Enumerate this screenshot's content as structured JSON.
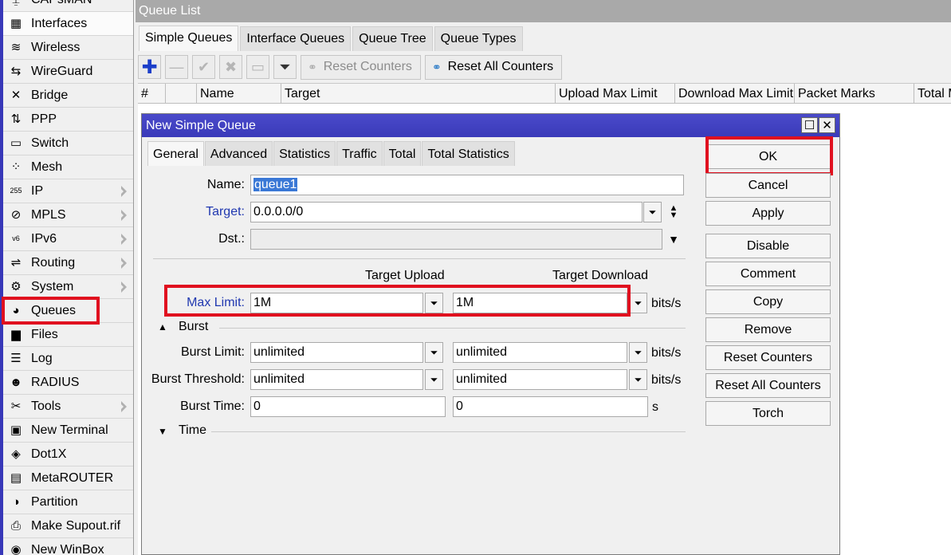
{
  "sidebar": {
    "items": [
      {
        "label": "CAPsMAN",
        "icon": "capsman-icon",
        "glyph": "⍊",
        "arrow": false
      },
      {
        "label": "Interfaces",
        "icon": "interfaces-icon",
        "glyph": "▦",
        "arrow": false
      },
      {
        "label": "Wireless",
        "icon": "wireless-icon",
        "glyph": "≋",
        "arrow": false
      },
      {
        "label": "WireGuard",
        "icon": "wireguard-icon",
        "glyph": "⇆",
        "arrow": false
      },
      {
        "label": "Bridge",
        "icon": "bridge-icon",
        "glyph": "✕",
        "arrow": false
      },
      {
        "label": "PPP",
        "icon": "ppp-icon",
        "glyph": "⇅",
        "arrow": false
      },
      {
        "label": "Switch",
        "icon": "switch-icon",
        "glyph": "▭",
        "arrow": false
      },
      {
        "label": "Mesh",
        "icon": "mesh-icon",
        "glyph": "⁘",
        "arrow": false
      },
      {
        "label": "IP",
        "icon": "ip-icon",
        "glyph": "255",
        "arrow": true
      },
      {
        "label": "MPLS",
        "icon": "mpls-icon",
        "glyph": "⊘",
        "arrow": true
      },
      {
        "label": "IPv6",
        "icon": "ipv6-icon",
        "glyph": "v6",
        "arrow": true
      },
      {
        "label": "Routing",
        "icon": "routing-icon",
        "glyph": "⇌",
        "arrow": true
      },
      {
        "label": "System",
        "icon": "system-icon",
        "glyph": "⚙",
        "arrow": true
      },
      {
        "label": "Queues",
        "icon": "queues-icon",
        "glyph": "◕",
        "arrow": false
      },
      {
        "label": "Files",
        "icon": "files-icon",
        "glyph": "▆",
        "arrow": false
      },
      {
        "label": "Log",
        "icon": "log-icon",
        "glyph": "☰",
        "arrow": false
      },
      {
        "label": "RADIUS",
        "icon": "radius-icon",
        "glyph": "☻",
        "arrow": false
      },
      {
        "label": "Tools",
        "icon": "tools-icon",
        "glyph": "✂",
        "arrow": true
      },
      {
        "label": "New Terminal",
        "icon": "terminal-icon",
        "glyph": "▣",
        "arrow": false
      },
      {
        "label": "Dot1X",
        "icon": "dot1x-icon",
        "glyph": "◈",
        "arrow": false
      },
      {
        "label": "MetaROUTER",
        "icon": "metarouter-icon",
        "glyph": "▤",
        "arrow": false
      },
      {
        "label": "Partition",
        "icon": "partition-icon",
        "glyph": "◑",
        "arrow": false
      },
      {
        "label": "Make Supout.rif",
        "icon": "supout-icon",
        "glyph": "⎙",
        "arrow": false
      },
      {
        "label": "New WinBox",
        "icon": "winbox-icon",
        "glyph": "◉",
        "arrow": false
      }
    ]
  },
  "queue_list": {
    "title": "Queue List",
    "tabs": [
      "Simple Queues",
      "Interface Queues",
      "Queue Tree",
      "Queue Types"
    ],
    "toolbar": {
      "reset_counters": "Reset Counters",
      "reset_all_counters": "Reset All Counters"
    },
    "columns": [
      "#",
      "",
      "Name",
      "Target",
      "Upload Max Limit",
      "Download Max Limit",
      "Packet Marks",
      "Total Max Limit"
    ]
  },
  "dialog": {
    "title": "New Simple Queue",
    "tabs": [
      "General",
      "Advanced",
      "Statistics",
      "Traffic",
      "Total",
      "Total Statistics"
    ],
    "form": {
      "name_label": "Name:",
      "name_value": "queue1",
      "target_label": "Target:",
      "target_value": "0.0.0.0/0",
      "dst_label": "Dst.:",
      "dst_value": "",
      "target_upload_header": "Target Upload",
      "target_download_header": "Target Download",
      "max_limit_label": "Max Limit:",
      "max_limit_upload": "1M",
      "max_limit_download": "1M",
      "bits_unit": "bits/s",
      "burst_section": "Burst",
      "burst_limit_label": "Burst Limit:",
      "burst_limit_upload": "unlimited",
      "burst_limit_download": "unlimited",
      "burst_threshold_label": "Burst Threshold:",
      "burst_threshold_upload": "unlimited",
      "burst_threshold_download": "unlimited",
      "burst_time_label": "Burst Time:",
      "burst_time_upload": "0",
      "burst_time_download": "0",
      "seconds_unit": "s",
      "time_section": "Time"
    },
    "buttons": [
      "OK",
      "Cancel",
      "Apply",
      "Disable",
      "Comment",
      "Copy",
      "Remove",
      "Reset Counters",
      "Reset All Counters",
      "Torch"
    ]
  },
  "colors": {
    "title_bar": "#3a3ab9",
    "highlight_box": "#e0101f",
    "link_label": "#2038b0"
  }
}
